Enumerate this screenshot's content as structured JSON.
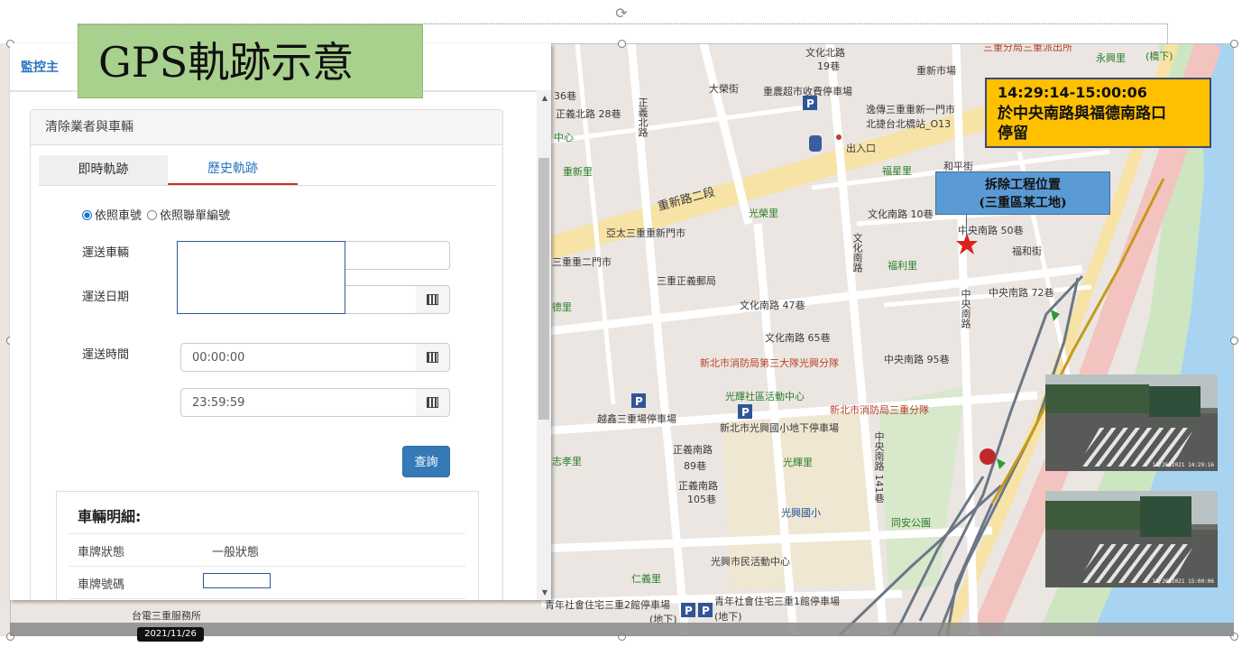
{
  "slide": {
    "title": "GPS軌跡示意",
    "time_note": {
      "line1": "14:29:14-15:00:06",
      "line2": "於中央南路與福德南路口",
      "line3": "停留"
    },
    "site_note": {
      "line1": "拆除工程位置",
      "line2": "(三重區某工地)"
    }
  },
  "app": {
    "top_tab": "監控主",
    "card_title": "清除業者與車輛",
    "tabs": [
      "即時軌跡",
      "歷史軌跡"
    ],
    "radio_options": [
      "依照車號",
      "依照聯單編號"
    ],
    "fields": {
      "vehicle_label": "運送車輛",
      "date_label": "運送日期",
      "time_label": "運送時間",
      "time_start": "00:00:00",
      "time_end": "23:59:59"
    },
    "query_button": "查詢",
    "detail": {
      "title": "車輛明細:",
      "rows": [
        {
          "label": "車牌狀態",
          "value": "一般狀態"
        },
        {
          "label": "車牌號碼",
          "value": ""
        }
      ]
    }
  },
  "map": {
    "labels": [
      "文化北路",
      "19巷",
      "重新市場",
      "永興里",
      "大榮街",
      "重農超市收費停車場",
      "逸傳三重重新一門市",
      "北捷台北橋站_O13",
      "出入口",
      "正義北路 28巷",
      "36巷",
      "正義北路",
      "中心",
      "重新里",
      "福星里",
      "和平街",
      "重新路二段",
      "光榮里",
      "文化南路 10巷",
      "中央南路 50巷",
      "福和街",
      "亞太三重重新門市",
      "三重重二門市",
      "三重正義郵局",
      "福利里",
      "中央南路 72巷",
      "文化南路 47巷",
      "德里",
      "文化南路 65巷",
      "中央南路 95巷",
      "新北市消防局第三大隊光興分隊",
      "光輝社區活動中心",
      "新北市消防局三重分隊",
      "新北市光興國小地下停車場",
      "越鑫三重場停車場",
      "正義南路",
      "89巷",
      "光輝里",
      "正義南路",
      "105巷",
      "光興國小",
      "志孝里",
      "同安公園",
      "光興市民活動中心",
      "仁義里",
      "青年社會住宅三重2館停車場",
      "青年社會住宅三重1館停車場",
      "(地下)",
      "(地下)",
      "文化南路",
      "中央南路",
      "中央南路 141巷",
      "台電三重服務所",
      "(橋下)",
      "三重分局三重派出所"
    ],
    "date_chip": "2021/11/26",
    "photo_stamps": [
      "11/26/2021 14:29:16",
      "11/26/2021 15:00:06"
    ]
  }
}
